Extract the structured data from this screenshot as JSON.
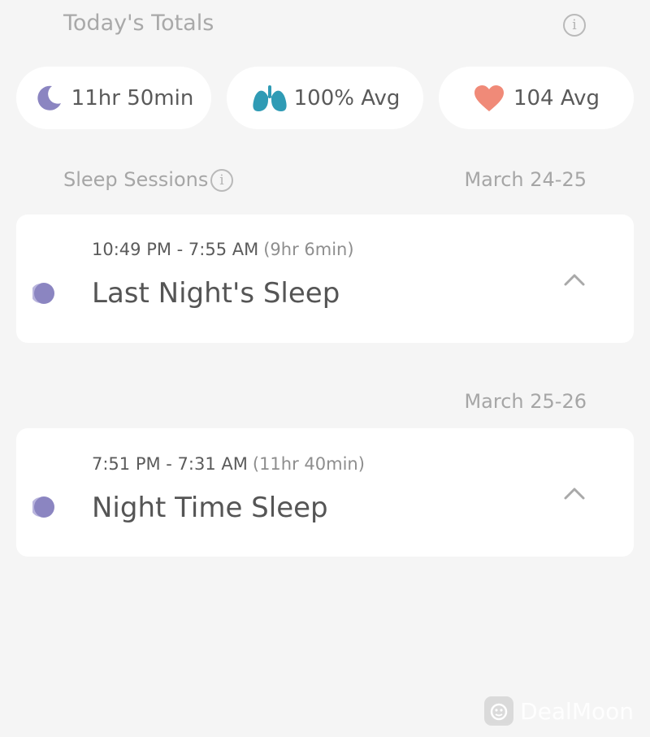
{
  "header": {
    "title": "Today's Totals"
  },
  "totals": [
    {
      "icon": "moon-icon",
      "value": "11hr 50min"
    },
    {
      "icon": "lungs-icon",
      "value": "100% Avg"
    },
    {
      "icon": "heart-icon",
      "value": "104 Avg"
    }
  ],
  "sessions_header": {
    "label": "Sleep Sessions"
  },
  "sessions": [
    {
      "date_range": "March 24-25",
      "time": "10:49 PM - 7:55 AM",
      "duration": "(9hr 6min)",
      "title": "Last Night's Sleep"
    },
    {
      "date_range": "March 25-26",
      "time": "7:51 PM - 7:31 AM",
      "duration": "(11hr 40min)",
      "title": "Night Time Sleep"
    }
  ],
  "watermark": {
    "text": "DealMoon"
  },
  "colors": {
    "background": "#f5f5f5",
    "card": "#ffffff",
    "moon": "#8b85c1",
    "lungs": "#2f9bb5",
    "heart": "#f08a78"
  }
}
